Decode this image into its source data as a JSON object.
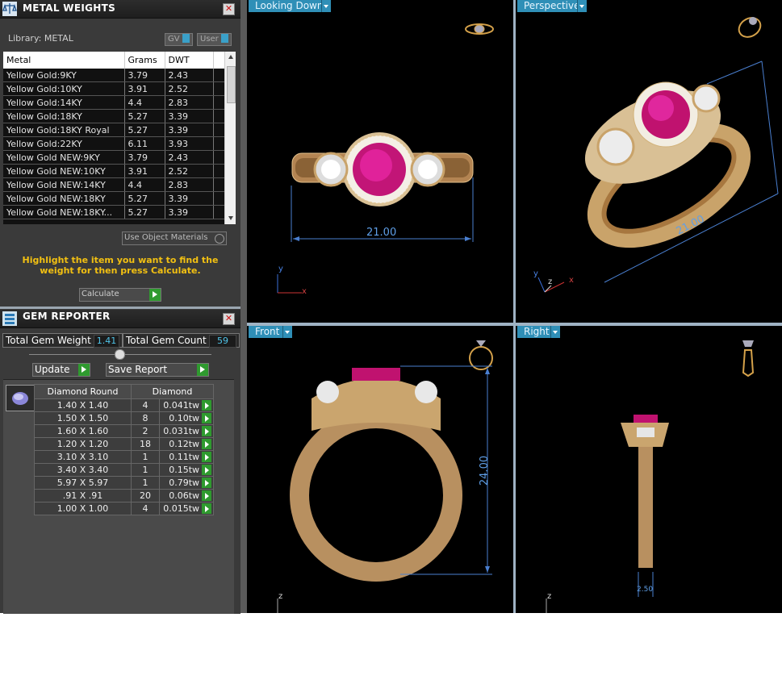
{
  "metal_panel": {
    "title": "METAL WEIGHTS",
    "library_label": "Library: METAL",
    "gv_label": "GV",
    "user_label": "User",
    "columns": [
      "Metal",
      "Grams",
      "DWT"
    ],
    "rows": [
      {
        "metal": "Yellow Gold:9KY",
        "grams": "3.79",
        "dwt": "2.43"
      },
      {
        "metal": "Yellow Gold:10KY",
        "grams": "3.91",
        "dwt": "2.52"
      },
      {
        "metal": "Yellow Gold:14KY",
        "grams": "4.4",
        "dwt": "2.83"
      },
      {
        "metal": "Yellow Gold:18KY",
        "grams": "5.27",
        "dwt": "3.39"
      },
      {
        "metal": "Yellow Gold:18KY Royal",
        "grams": "5.27",
        "dwt": "3.39"
      },
      {
        "metal": "Yellow Gold:22KY",
        "grams": "6.11",
        "dwt": "3.93"
      },
      {
        "metal": "Yellow Gold NEW:9KY",
        "grams": "3.79",
        "dwt": "2.43"
      },
      {
        "metal": "Yellow Gold NEW:10KY",
        "grams": "3.91",
        "dwt": "2.52"
      },
      {
        "metal": "Yellow Gold NEW:14KY",
        "grams": "4.4",
        "dwt": "2.83"
      },
      {
        "metal": "Yellow Gold NEW:18KY",
        "grams": "5.27",
        "dwt": "3.39"
      },
      {
        "metal": "Yellow Gold NEW:18KY...",
        "grams": "5.27",
        "dwt": "3.39"
      }
    ],
    "use_object_materials": "Use Object Materials",
    "hint": "Highlight the item you want to find the weight for then press Calculate.",
    "calculate_label": "Calculate"
  },
  "gem_panel": {
    "title": "GEM REPORTER",
    "total_weight_label": "Total Gem Weight",
    "total_weight_value": "1.41",
    "total_count_label": "Total Gem Count",
    "total_count_value": "59",
    "update_label": "Update",
    "save_report_label": "Save Report",
    "col_shape": "Diamond Round",
    "col_type": "Diamond",
    "rows": [
      {
        "size": "1.40 X 1.40",
        "count": "4",
        "weight": "0.041tw"
      },
      {
        "size": "1.50 X 1.50",
        "count": "8",
        "weight": "0.10tw"
      },
      {
        "size": "1.60 X 1.60",
        "count": "2",
        "weight": "0.031tw"
      },
      {
        "size": "1.20 X 1.20",
        "count": "18",
        "weight": "0.12tw"
      },
      {
        "size": "3.10 X 3.10",
        "count": "1",
        "weight": "0.11tw"
      },
      {
        "size": "3.40 X 3.40",
        "count": "1",
        "weight": "0.15tw"
      },
      {
        "size": "5.97 X 5.97",
        "count": "1",
        "weight": "0.79tw"
      },
      {
        "size": ".91 X .91",
        "count": "20",
        "weight": "0.06tw"
      },
      {
        "size": "1.00 X 1.00",
        "count": "4",
        "weight": "0.015tw"
      }
    ]
  },
  "viewports": {
    "top_left": {
      "label": "Looking Down",
      "dimension": "21.00",
      "axis_a": "y",
      "axis_b": "x"
    },
    "top_right": {
      "label": "Perspective",
      "dimension": "21.00",
      "axis_z": "z",
      "axis_x": "x",
      "axis_y": "y"
    },
    "bottom_left": {
      "label": "Front",
      "dimension": "24.00",
      "axis_z": "z"
    },
    "bottom_right": {
      "label": "Right",
      "dimension": "2.50",
      "axis_z": "z"
    }
  },
  "colors": {
    "accent": "#2f8fb7",
    "gold": "#c9a36a",
    "ruby": "#d0197a",
    "hint_text": "#f2c012",
    "dimension_line": "#4a7fd0"
  }
}
